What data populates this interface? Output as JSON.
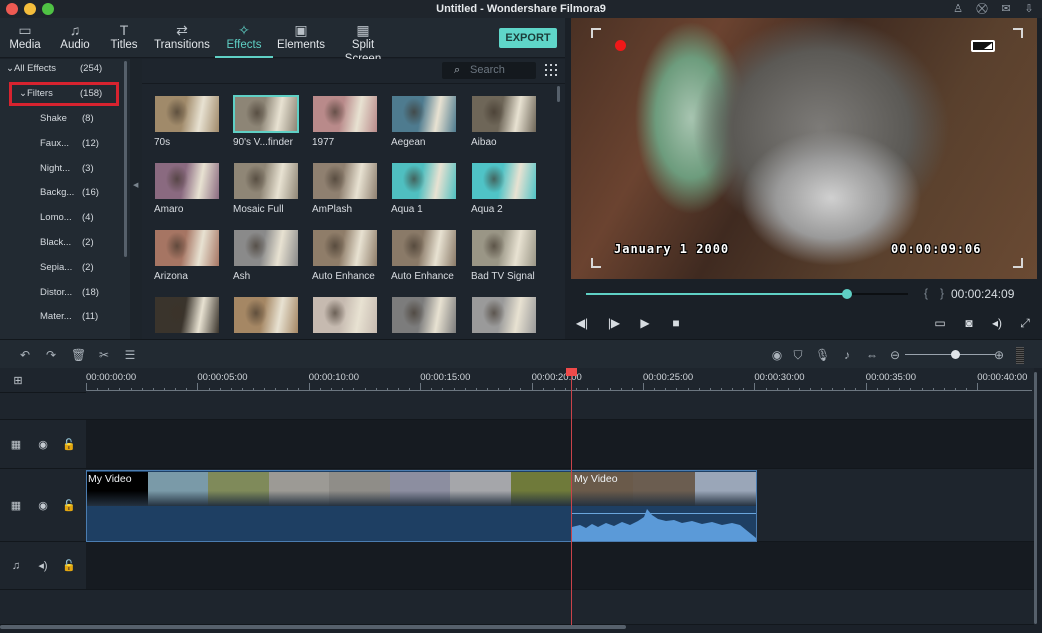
{
  "window": {
    "title": "Untitled - Wondershare Filmora9",
    "traffic_lights": [
      "close",
      "minimize",
      "maximize"
    ],
    "title_icons": [
      "user-icon",
      "cart-icon",
      "mail-icon",
      "download-icon"
    ]
  },
  "tabs": [
    {
      "label": "Media",
      "icon": "folder-icon",
      "glyph": "▭"
    },
    {
      "label": "Audio",
      "icon": "music-note-icon",
      "glyph": "♫"
    },
    {
      "label": "Titles",
      "icon": "text-icon",
      "glyph": "T"
    },
    {
      "label": "Transitions",
      "icon": "transitions-icon",
      "glyph": "⇄"
    },
    {
      "label": "Effects",
      "icon": "effects-icon",
      "glyph": "✧",
      "active": true
    },
    {
      "label": "Elements",
      "icon": "image-icon",
      "glyph": "▣"
    },
    {
      "label": "Split Screen",
      "icon": "split-screen-icon",
      "glyph": "▦"
    }
  ],
  "export_label": "EXPORT",
  "tree": {
    "root": {
      "label": "All Effects",
      "count": "(254)"
    },
    "selected": {
      "label": "Filters",
      "count": "(158)"
    },
    "children": [
      {
        "label": "Shake",
        "count": "(8)"
      },
      {
        "label": "Faux...",
        "count": "(12)"
      },
      {
        "label": "Night...",
        "count": "(3)"
      },
      {
        "label": "Backg...",
        "count": "(16)"
      },
      {
        "label": "Lomo...",
        "count": "(4)"
      },
      {
        "label": "Black...",
        "count": "(2)"
      },
      {
        "label": "Sepia...",
        "count": "(2)"
      },
      {
        "label": "Distor...",
        "count": "(18)"
      },
      {
        "label": "Mater...",
        "count": "(11)"
      }
    ]
  },
  "search": {
    "placeholder": "Search"
  },
  "effects": [
    {
      "label": "70s",
      "tint": "#a08a6a"
    },
    {
      "label": "90's V...finder",
      "tint": "#8d8576",
      "selected": true
    },
    {
      "label": "1977",
      "tint": "#b98a8a"
    },
    {
      "label": "Aegean",
      "tint": "#4e7b8f"
    },
    {
      "label": "Aibao",
      "tint": "#6e6658"
    },
    {
      "label": "Amaro",
      "tint": "#8a6a80"
    },
    {
      "label": "Mosaic Full",
      "tint": "#8f8676"
    },
    {
      "label": "AmPlash",
      "tint": "#8f8070"
    },
    {
      "label": "Aqua 1",
      "tint": "#4fbfc0"
    },
    {
      "label": "Aqua 2",
      "tint": "#4fc3c6"
    },
    {
      "label": "Arizona",
      "tint": "#a67563"
    },
    {
      "label": "Ash",
      "tint": "#8a8a8a"
    },
    {
      "label": "Auto Enhance",
      "tint": "#8f7d69"
    },
    {
      "label": "Auto Enhance",
      "tint": "#8a7a68"
    },
    {
      "label": "Bad TV Signal",
      "tint": "#9a9686"
    },
    {
      "label": "",
      "tint": "#3a342c"
    },
    {
      "label": "",
      "tint": "#a58764"
    },
    {
      "label": "",
      "tint": "#c6bab0"
    },
    {
      "label": "",
      "tint": "#7c7c7c"
    },
    {
      "label": "",
      "tint": "#9a9a9a"
    }
  ],
  "preview": {
    "osd_date": "January 1 2000",
    "osd_time": "00:00:09:06",
    "progress": 0.81,
    "current_time": "00:00:24:09",
    "bracket_in": "{",
    "bracket_out": "}",
    "controls": [
      "previous-frame",
      "next-frame",
      "play",
      "stop"
    ],
    "right_controls": [
      "render-settings",
      "snapshot",
      "volume",
      "fullscreen"
    ]
  },
  "timeline_toolbar": {
    "left": [
      "undo",
      "redo",
      "delete",
      "cut",
      "adjust"
    ],
    "right": [
      "render-preview",
      "marker",
      "voiceover",
      "audio-mixer",
      "fit-timeline",
      "zoom-out",
      "zoom-in"
    ],
    "zoom_level": 0.55
  },
  "ruler": {
    "labels": [
      "00:00:00:00",
      "00:00:05:00",
      "00:00:10:00",
      "00:00:15:00",
      "00:00:20:00",
      "00:00:25:00",
      "00:00:30:00",
      "00:00:35:00",
      "00:00:40:00"
    ],
    "playhead_time": "00:00:21:00"
  },
  "tracks": [
    {
      "type": "video",
      "icons": [
        "film-icon",
        "eye-icon",
        "lock-icon"
      ]
    },
    {
      "type": "video",
      "icons": [
        "film-icon",
        "eye-icon",
        "lock-icon"
      ]
    },
    {
      "type": "audio",
      "icons": [
        "music-icon",
        "speaker-icon",
        "lock-icon"
      ]
    }
  ],
  "clips": [
    {
      "label": "My Video",
      "frames": [
        "#000000",
        "#7a9aa8",
        "#7f8a5a",
        "#9c9a95",
        "#8f8d88",
        "#8c8ea0",
        "#a5a6aa",
        "#6f7a3a"
      ]
    },
    {
      "label": "My Video",
      "frames": [
        "#6a5a4a",
        "#6b5d50",
        "#9aa6b8"
      ]
    }
  ],
  "colors": {
    "accent": "#5fd0c5",
    "playhead": "#ef4a4a",
    "clip": "#1e3f63",
    "audio_wave": "#5b9ad8",
    "highlight_box": "#d7232f"
  }
}
